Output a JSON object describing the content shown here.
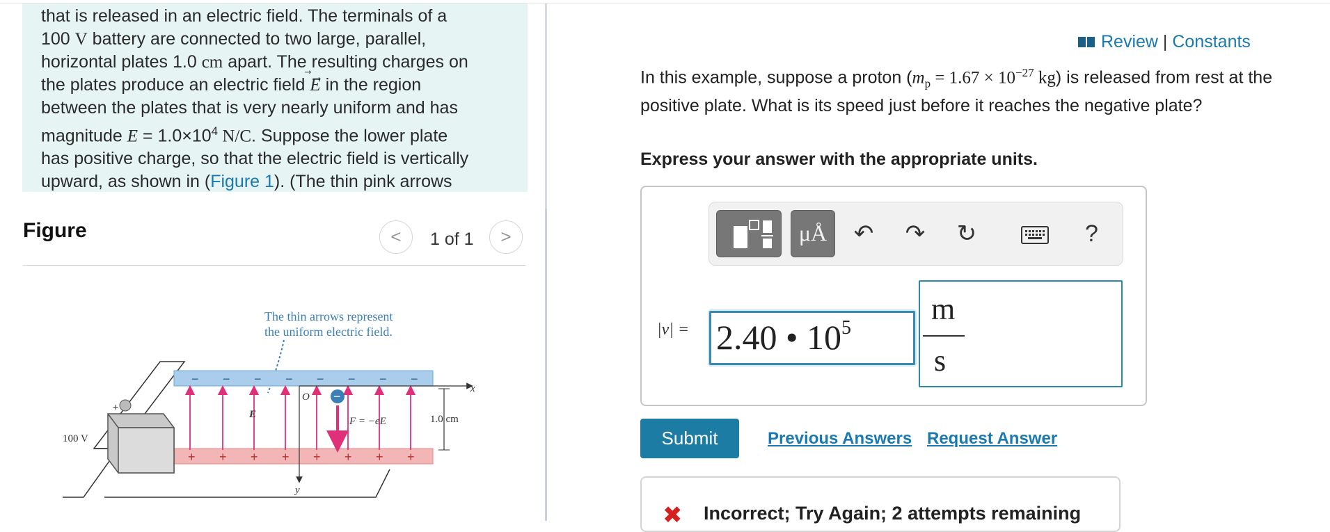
{
  "intro": {
    "line1": "that is released in an electric field. The terminals of a",
    "line2_a": "100 ",
    "line2_unit": "V",
    "line2_b": " battery are connected to two large, parallel,",
    "line3_a": "horizontal plates 1.0 ",
    "line3_unit": "cm",
    "line3_b": " apart. The resulting charges on",
    "line4_a": "the plates produce an electric field ",
    "line4_sym": "E",
    "line4_b": " in the region",
    "line5": "between the plates that is very nearly uniform and has",
    "line6_a": "magnitude ",
    "line6_sym": "E",
    "line6_b": " = 1.0×10",
    "line6_exp": "4",
    "line6_unit": " N/C",
    "line6_c": ". Suppose the lower plate",
    "line7": "has positive charge, so that the electric field is vertically",
    "line8_a": "upward, as shown in (",
    "line8_link": "Figure 1",
    "line8_b": "). (The thin pink arrows"
  },
  "figure_panel": {
    "title": "Figure",
    "prev_icon": "<",
    "next_icon": ">",
    "count": "1 of 1",
    "caption_line1": "The thin arrows represent",
    "caption_line2": "the uniform electric field.",
    "battery_label": "100 V",
    "origin_label": "O",
    "e_label": "E",
    "force_label": "F = −eE",
    "gap_label": "1.0 cm",
    "x_axis": "x",
    "y_axis": "y",
    "plus": "+",
    "minus": "−"
  },
  "header": {
    "review": "Review",
    "separator": " | ",
    "constants": "Constants"
  },
  "question": {
    "text_a": "In this example, suppose a proton (",
    "mass_sym": "m",
    "mass_sub": "p",
    "mass_val": " = 1.67 × 10",
    "mass_exp": "−27",
    "mass_unit": " kg",
    "text_b": ") is released from rest at the positive plate. What is its speed just before it reaches the negative plate?",
    "instruction": "Express your answer with the appropriate units."
  },
  "toolbar": {
    "templates_icon": "templates-icon",
    "units_label": "μÅ",
    "undo_icon": "↶",
    "redo_icon": "↷",
    "reset_icon": "↻",
    "keyboard_icon": "keyboard-icon",
    "help_label": "?"
  },
  "answer": {
    "label": "|v| =",
    "value_mantissa": "2.40 • 10",
    "value_exp": "5",
    "unit_numerator": "m",
    "unit_denominator": "s"
  },
  "actions": {
    "submit": "Submit",
    "previous_answers": "Previous Answers",
    "request_answer": "Request Answer"
  },
  "feedback": {
    "icon": "✖",
    "text": "Incorrect; Try Again; 2 attempts remaining"
  },
  "colors": {
    "accent": "#1d7ca3",
    "link": "#1a7ab0",
    "intro_bg": "#e6f4f4",
    "error": "#d62020",
    "field_arrow": "#e0307a",
    "neg_plate": "#a9cdea",
    "pos_plate": "#f3b6b6"
  }
}
